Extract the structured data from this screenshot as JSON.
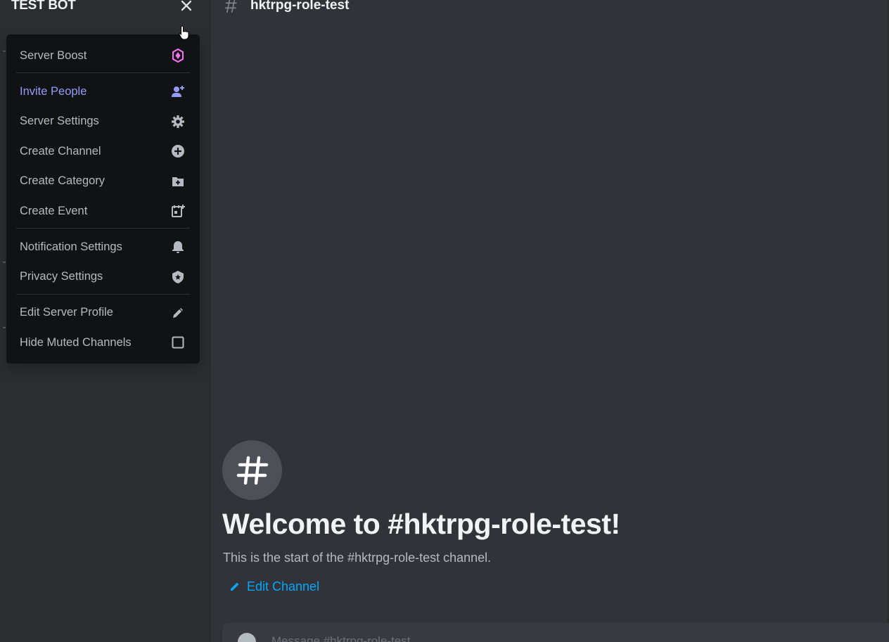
{
  "server": {
    "name": "TEST BOT",
    "close_icon": "close-icon"
  },
  "menu": {
    "items": [
      {
        "label": "Server Boost",
        "icon": "boost-icon"
      },
      {
        "label": "Invite People",
        "icon": "add-person-icon"
      },
      {
        "label": "Server Settings",
        "icon": "gear-icon"
      },
      {
        "label": "Create Channel",
        "icon": "plus-circle-icon"
      },
      {
        "label": "Create Category",
        "icon": "folder-plus-icon"
      },
      {
        "label": "Create Event",
        "icon": "calendar-plus-icon"
      },
      {
        "label": "Notification Settings",
        "icon": "bell-icon"
      },
      {
        "label": "Privacy Settings",
        "icon": "shield-icon"
      },
      {
        "label": "Edit Server Profile",
        "icon": "pencil-icon"
      },
      {
        "label": "Hide Muted Channels",
        "icon": "checkbox-icon"
      }
    ]
  },
  "channel": {
    "name": "hktrpg-role-test",
    "welcome_title": "Welcome to #hktrpg-role-test!",
    "welcome_subtitle": "This is the start of the #hktrpg-role-test channel.",
    "edit_label": "Edit Channel",
    "message_placeholder": "Message #hktrpg-role-test"
  },
  "colors": {
    "accent_invite": "#949cf7",
    "boost": "#ff73fa",
    "link": "#00a8fc"
  }
}
